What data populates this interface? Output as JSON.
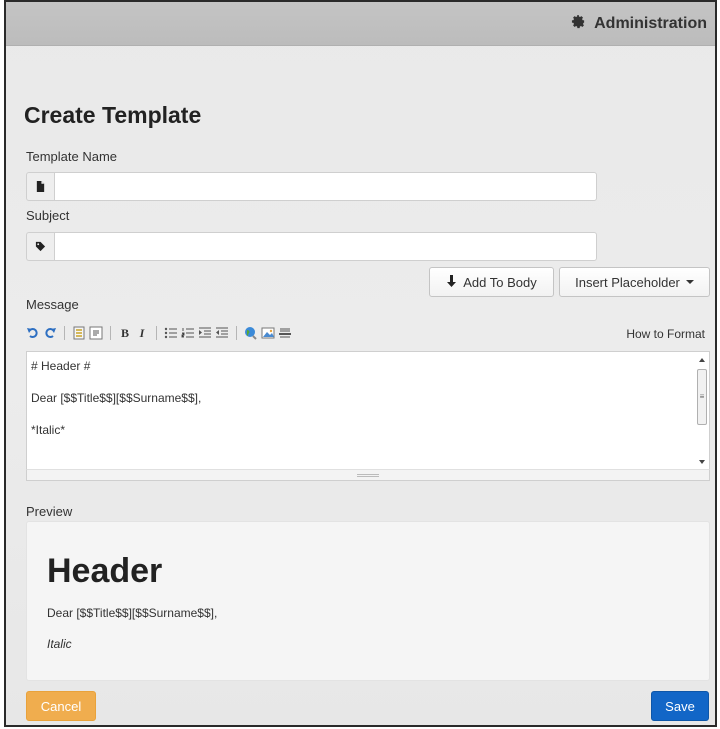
{
  "header": {
    "admin_label": "Administration",
    "admin_icon": "gear-icon"
  },
  "form": {
    "title": "Create Template",
    "template_name": {
      "label": "Template Name",
      "value": "",
      "placeholder": "",
      "icon": "file-icon"
    },
    "subject": {
      "label": "Subject",
      "value": "",
      "placeholder": "",
      "icon": "tag-icon"
    },
    "add_to_body_label": "Add To Body",
    "insert_placeholder_label": "Insert Placeholder",
    "message_label": "Message",
    "toolbar_icons": [
      "undo-icon",
      "redo-icon",
      "code-icon",
      "quote-icon",
      "bold-icon",
      "italic-icon",
      "unordered-list-icon",
      "ordered-list-icon",
      "indent-icon",
      "outdent-icon",
      "link-icon",
      "image-icon",
      "horizontal-rule-icon"
    ],
    "how_to_format_label": "How to Format",
    "message_lines": [
      "# Header #",
      "Dear [$$Title$$][$$Surname$$],",
      "*Italic*"
    ]
  },
  "preview": {
    "label": "Preview",
    "heading": "Header",
    "greeting": "Dear [$$Title$$][$$Surname$$],",
    "italic_text": "Italic"
  },
  "actions": {
    "cancel_label": "Cancel",
    "save_label": "Save"
  },
  "colors": {
    "cancel": "#f0ad4e",
    "save": "#1266c7",
    "topbar": "#c0c0c0",
    "background": "#ebebeb"
  }
}
